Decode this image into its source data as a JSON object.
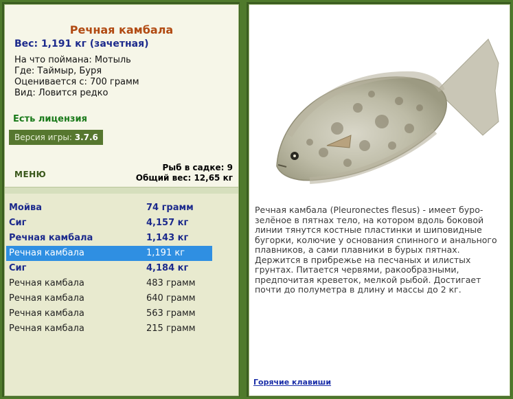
{
  "catch": {
    "title": "Речная камбала",
    "weight_line": "Вес: 1,191 кг (зачетная)",
    "bait": "На что поймана: Мотыль",
    "location": "Где: Таймыр, Буря",
    "valued_from": "Оценивается с: 700 грамм",
    "kind": "Вид: Ловится редко"
  },
  "license_text": "Есть лицензия",
  "version": {
    "label": "Версия игры:",
    "value": "3.7.6"
  },
  "menu_label": "МЕНЮ",
  "stats": {
    "count_line": "Рыб в садке: 9",
    "total_line": "Общий вес: 12,65 кг"
  },
  "fish_list": [
    {
      "name": "Мойва",
      "weight": "74 грамм",
      "trophy": true,
      "selected": false
    },
    {
      "name": "Сиг",
      "weight": "4,157 кг",
      "trophy": true,
      "selected": false
    },
    {
      "name": "Речная камбала",
      "weight": "1,143 кг",
      "trophy": true,
      "selected": false
    },
    {
      "name": "Речная камбала",
      "weight": "1,191 кг",
      "trophy": true,
      "selected": true
    },
    {
      "name": "Сиг",
      "weight": "4,184 кг",
      "trophy": true,
      "selected": false
    },
    {
      "name": "Речная камбала",
      "weight": "483 грамм",
      "trophy": false,
      "selected": false
    },
    {
      "name": "Речная камбала",
      "weight": "640 грамм",
      "trophy": false,
      "selected": false
    },
    {
      "name": "Речная камбала",
      "weight": "563 грамм",
      "trophy": false,
      "selected": false
    },
    {
      "name": "Речная камбала",
      "weight": "215 грамм",
      "trophy": false,
      "selected": false
    }
  ],
  "description": "Речная камбала (Pleuronectes flesus) - имеет буро-зелёное в пятнах тело, на котором вдоль боковой линии тянутся костные пластинки и шиповидные бугорки, колючие у основания спинного и анального плавников, а сами плавники в бурых пятнах. Держится в прибрежье на песчаных и илистых грунтах. Питается червями, ракообразными, предпочитая креветок, мелкой рыбой. Достигает почти до полуметра в длину и массы до 2 кг.",
  "hotkeys_label": "Горячие клавиши",
  "colors": {
    "frame": "#4f7a2c",
    "title": "#b14a12",
    "trophy_text": "#1c2a8c",
    "selection": "#2f8fe2",
    "license": "#1a7a1a"
  },
  "icons": {
    "fish_picture": "flounder-image"
  }
}
